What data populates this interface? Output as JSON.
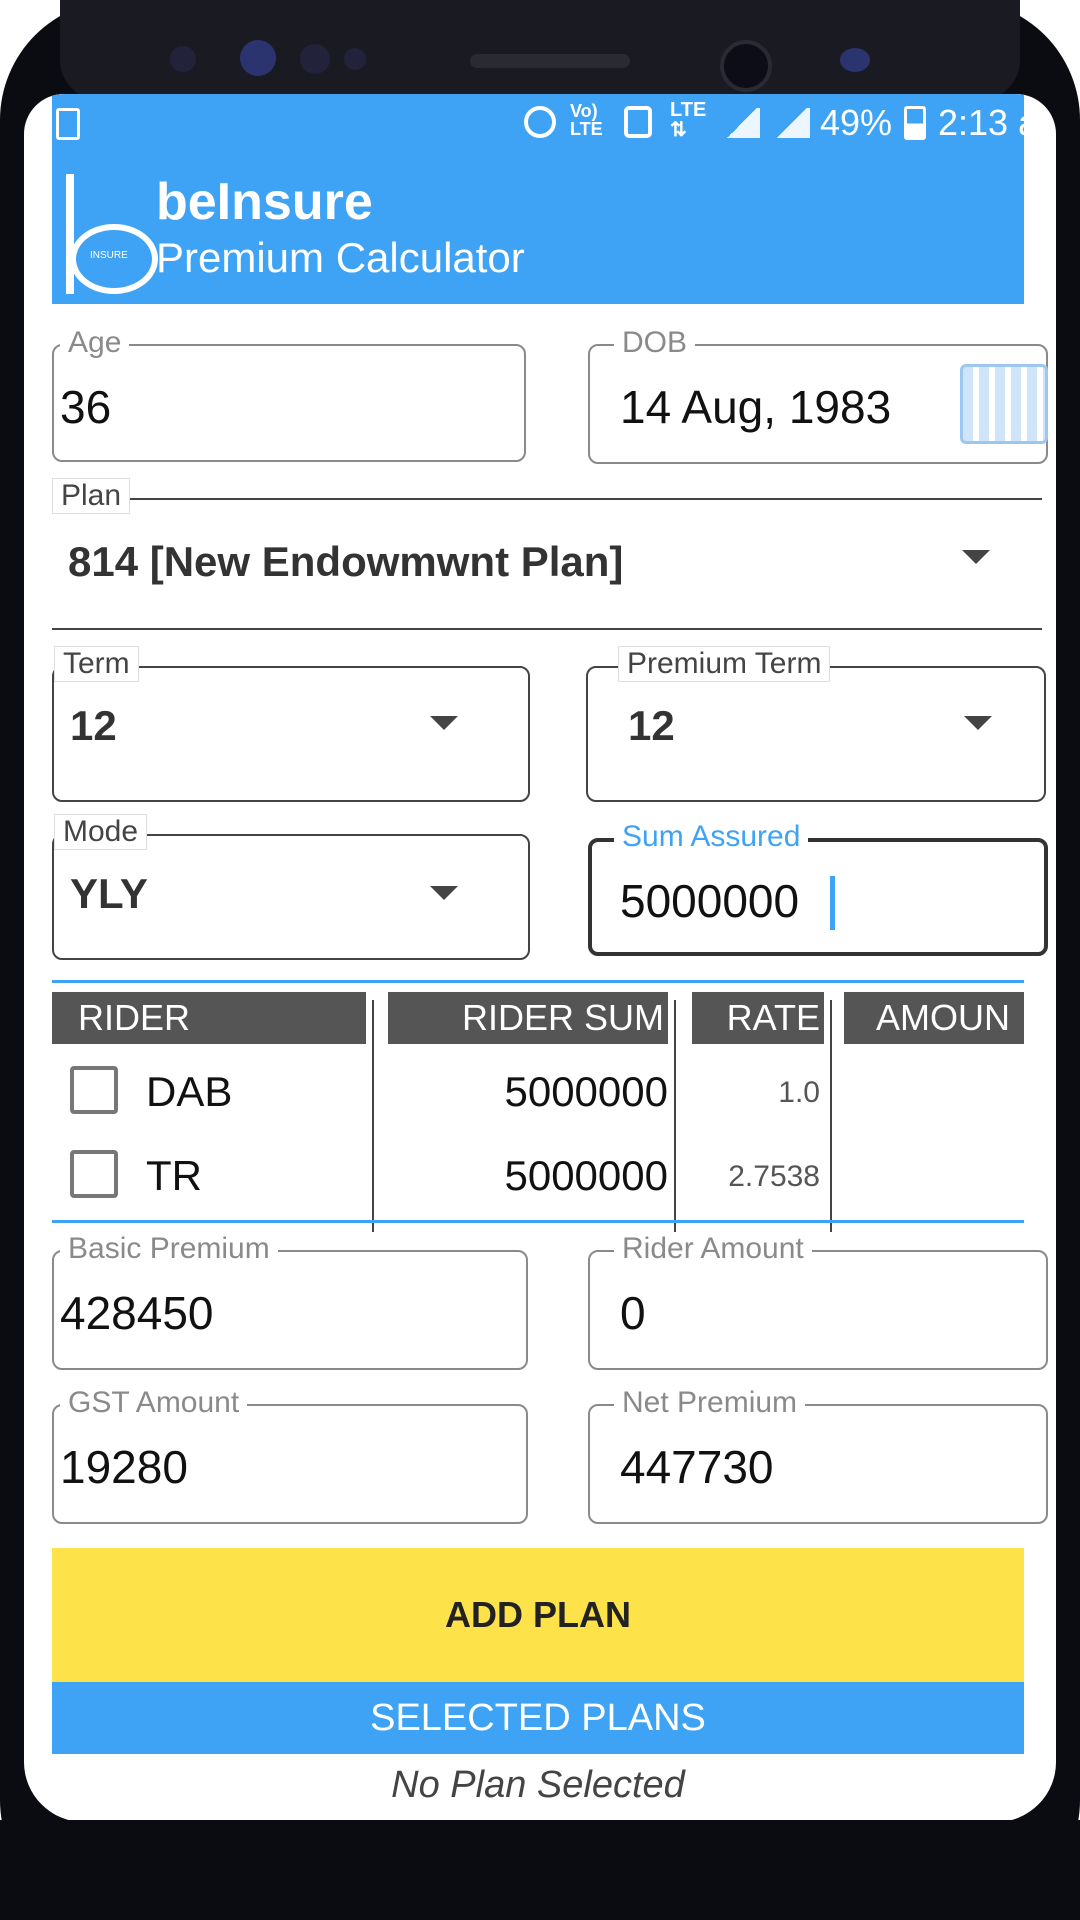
{
  "statusbar": {
    "indicators": [
      "alarm-icon",
      "volte-icon",
      "nfc-icon",
      "lte-icon",
      "signal-icon",
      "signal-icon",
      "battery-icon"
    ],
    "battery": "49%",
    "time": "2:13 a"
  },
  "appbar": {
    "logo_text": "INSURE",
    "title": "beInsure",
    "subtitle": "Premium Calculator"
  },
  "form": {
    "age_label": "Age",
    "age_value": "36",
    "dob_label": "DOB",
    "dob_value": "14 Aug, 1983",
    "plan_label": "Plan",
    "plan_value": "814 [New Endowmwnt Plan]",
    "term_label": "Term",
    "term_value": "12",
    "premium_term_label": "Premium Term",
    "premium_term_value": "12",
    "mode_label": "Mode",
    "mode_value": "YLY",
    "sum_assured_label": "Sum Assured",
    "sum_assured_value": "5000000"
  },
  "rider_table": {
    "headers": [
      "RIDER",
      "RIDER SUM",
      "RATE",
      "AMOUN"
    ],
    "rows": [
      {
        "name": "DAB",
        "sum": "5000000",
        "rate": "1.0",
        "amount": "",
        "checked": false
      },
      {
        "name": "TR",
        "sum": "5000000",
        "rate": "2.7538",
        "amount": "",
        "checked": false
      }
    ]
  },
  "results": {
    "basic_premium_label": "Basic Premium",
    "basic_premium_value": "428450",
    "rider_amount_label": "Rider Amount",
    "rider_amount_value": "0",
    "gst_amount_label": "GST Amount",
    "gst_amount_value": "19280",
    "net_premium_label": "Net Premium",
    "net_premium_value": "447730"
  },
  "actions": {
    "add_plan_label": "ADD PLAN",
    "selected_plans_label": "SELECTED PLANS",
    "no_plan_text": "No Plan Selected"
  },
  "colors": {
    "primary": "#3fa3f5",
    "accent_button": "#fde24a",
    "header_dark": "#555555"
  }
}
